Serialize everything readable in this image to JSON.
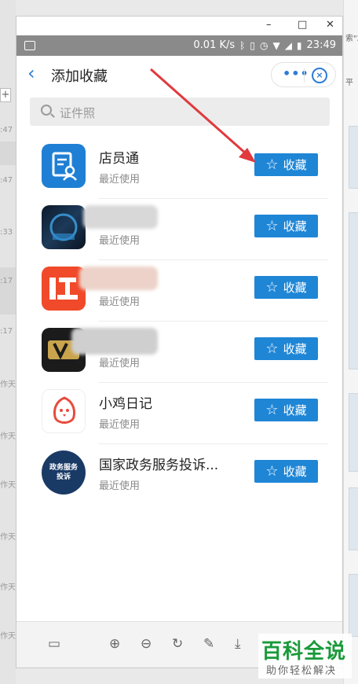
{
  "background_left": {
    "timestamps": [
      ":47",
      ":47",
      ":33",
      ":17",
      ":17",
      "作天",
      "作天",
      "作天",
      "作天",
      "作天",
      "作天"
    ]
  },
  "background_right": {
    "texts": [
      "索\"2",
      "平"
    ]
  },
  "window_controls": {
    "minimize": "–",
    "maximize": "□",
    "close": "✕"
  },
  "status_bar": {
    "speed": "0.01 K/s",
    "time": "23:49",
    "icons": [
      "image-icon",
      "bluetooth-icon",
      "vibrate-icon",
      "alarm-icon",
      "wifi-icon",
      "signal-icon",
      "battery-icon"
    ]
  },
  "header": {
    "back_icon": "‹",
    "title": "添加收藏",
    "more_label": "•••",
    "close_icon": "⊗"
  },
  "search": {
    "placeholder": "证件照"
  },
  "apps": [
    {
      "name": "店员通",
      "sub": "最近使用",
      "button": "收藏"
    },
    {
      "name": "",
      "sub": "最近使用",
      "button": "收藏"
    },
    {
      "name": "",
      "sub": "最近使用",
      "button": "收藏"
    },
    {
      "name": "",
      "sub": "最近使用",
      "button": "收藏"
    },
    {
      "name": "小鸡日记",
      "sub": "最近使用",
      "button": "收藏"
    },
    {
      "name": "国家政务服务投诉...",
      "sub": "最近使用",
      "button": "收藏",
      "icon_text": "政务服务\n投诉"
    }
  ],
  "toolbar": {
    "icons": [
      "screen-icon",
      "zoom-in-icon",
      "zoom-out-icon",
      "rotate-icon",
      "edit-icon",
      "download-icon"
    ]
  },
  "watermark": {
    "main": "百科全说",
    "sub": "助你轻松解决"
  },
  "colors": {
    "accent": "#1f86d6",
    "arrow": "#e0393e"
  }
}
